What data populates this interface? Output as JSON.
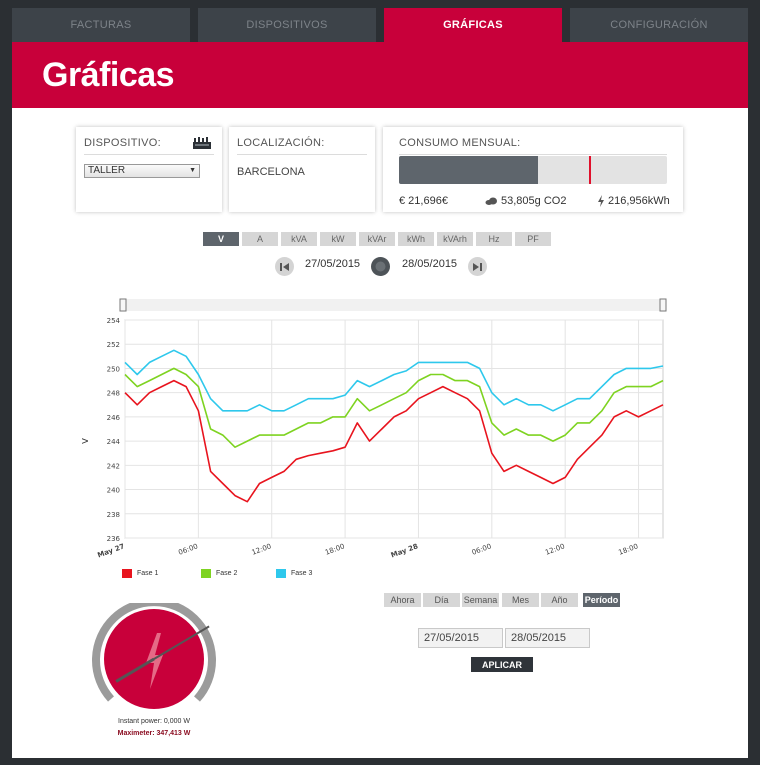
{
  "tabs": [
    {
      "label": "FACTURAS"
    },
    {
      "label": "DISPOSITIVOS"
    },
    {
      "label": "GRÁFICAS"
    },
    {
      "label": "CONFIGURACIÓN"
    }
  ],
  "header": {
    "title": "Gráficas"
  },
  "device_card": {
    "title": "DISPOSITIVO:",
    "selected": "TALLER",
    "icon": "device-strip-icon"
  },
  "location_card": {
    "title": "LOCALIZACIÓN:",
    "value": "BARCELONA"
  },
  "consumption_card": {
    "title": "CONSUMO MENSUAL:",
    "fill_fraction": 0.52,
    "marker_fraction": 0.71,
    "cost": "€ 21,696€",
    "co2": "53,805g CO2",
    "energy": "216,956kWh"
  },
  "units": [
    "V",
    "A",
    "kVA",
    "kW",
    "kVAr",
    "kWh",
    "kVArh",
    "Hz",
    "PF"
  ],
  "active_unit": "V",
  "date_nav": {
    "from": "27/05/2015",
    "to": "28/05/2015"
  },
  "chart_data": {
    "type": "line",
    "ylabel": "V",
    "ylim": [
      236,
      254
    ],
    "yticks": [
      236,
      238,
      240,
      242,
      244,
      246,
      248,
      250,
      252,
      254
    ],
    "x_range_hours": [
      0,
      44
    ],
    "xticks": [
      {
        "label": "May 27",
        "h": 0,
        "bold": true
      },
      {
        "label": "06:00",
        "h": 6
      },
      {
        "label": "12:00",
        "h": 12
      },
      {
        "label": "18:00",
        "h": 18
      },
      {
        "label": "May 28",
        "h": 24,
        "bold": true
      },
      {
        "label": "06:00",
        "h": 30
      },
      {
        "label": "12:00",
        "h": 36
      },
      {
        "label": "18:00",
        "h": 42
      }
    ],
    "x": [
      0,
      1,
      2,
      3,
      4,
      5,
      6,
      7,
      8,
      9,
      10,
      11,
      12,
      13,
      14,
      15,
      16,
      17,
      18,
      19,
      20,
      21,
      22,
      23,
      24,
      25,
      26,
      27,
      28,
      29,
      30,
      31,
      32,
      33,
      34,
      35,
      36,
      37,
      38,
      39,
      40,
      41,
      42,
      43,
      44
    ],
    "series": [
      {
        "name": "Fase 1",
        "color": "#e8141e",
        "values": [
          248.0,
          247.0,
          248.0,
          248.5,
          249.0,
          248.5,
          246.5,
          241.5,
          240.5,
          239.5,
          239.0,
          240.5,
          241.0,
          241.5,
          242.5,
          242.8,
          243.0,
          243.2,
          243.5,
          245.5,
          244.0,
          245.0,
          246.0,
          246.5,
          247.5,
          248.0,
          248.5,
          248.0,
          247.5,
          246.5,
          243.0,
          241.5,
          242.0,
          241.5,
          241.0,
          240.5,
          241.0,
          242.5,
          243.5,
          244.5,
          246.0,
          246.5,
          246.0,
          246.5,
          247.0
        ]
      },
      {
        "name": "Fase 2",
        "color": "#7ed321",
        "values": [
          249.5,
          248.5,
          249.0,
          249.5,
          250.0,
          249.5,
          248.5,
          245.0,
          244.5,
          243.5,
          244.0,
          244.5,
          244.5,
          244.5,
          245.0,
          245.5,
          245.5,
          246.0,
          246.0,
          247.5,
          246.5,
          247.0,
          247.5,
          248.0,
          249.0,
          249.5,
          249.5,
          249.0,
          249.0,
          248.5,
          245.5,
          244.5,
          245.0,
          244.5,
          244.5,
          244.0,
          244.5,
          245.5,
          245.5,
          246.5,
          248.0,
          248.5,
          248.5,
          248.5,
          249.0
        ]
      },
      {
        "name": "Fase 3",
        "color": "#2ec8ec",
        "values": [
          250.5,
          249.5,
          250.5,
          251.0,
          251.5,
          251.0,
          249.5,
          247.5,
          246.5,
          246.5,
          246.5,
          247.0,
          246.5,
          246.5,
          247.0,
          247.5,
          247.5,
          247.5,
          247.8,
          249.0,
          248.5,
          249.0,
          249.5,
          249.8,
          250.5,
          250.5,
          250.5,
          250.5,
          250.5,
          250.0,
          248.0,
          247.0,
          247.5,
          247.0,
          247.0,
          246.5,
          247.0,
          247.5,
          247.5,
          248.5,
          249.5,
          250.0,
          250.0,
          250.0,
          250.2
        ]
      }
    ],
    "legend": "bottom-left",
    "grid": true
  },
  "periods": [
    "Ahora",
    "Día",
    "Semana",
    "Mes",
    "Año",
    "Período"
  ],
  "active_period": "Período",
  "range": {
    "from": "27/05/2015",
    "to": "28/05/2015",
    "apply_label": "APLICAR"
  },
  "gauge": {
    "instant_label": "Instant power: 0,000 W",
    "max_label": "Maximeter: 347,413 W",
    "needle_fraction": 0.72,
    "color": "#c8003a"
  }
}
